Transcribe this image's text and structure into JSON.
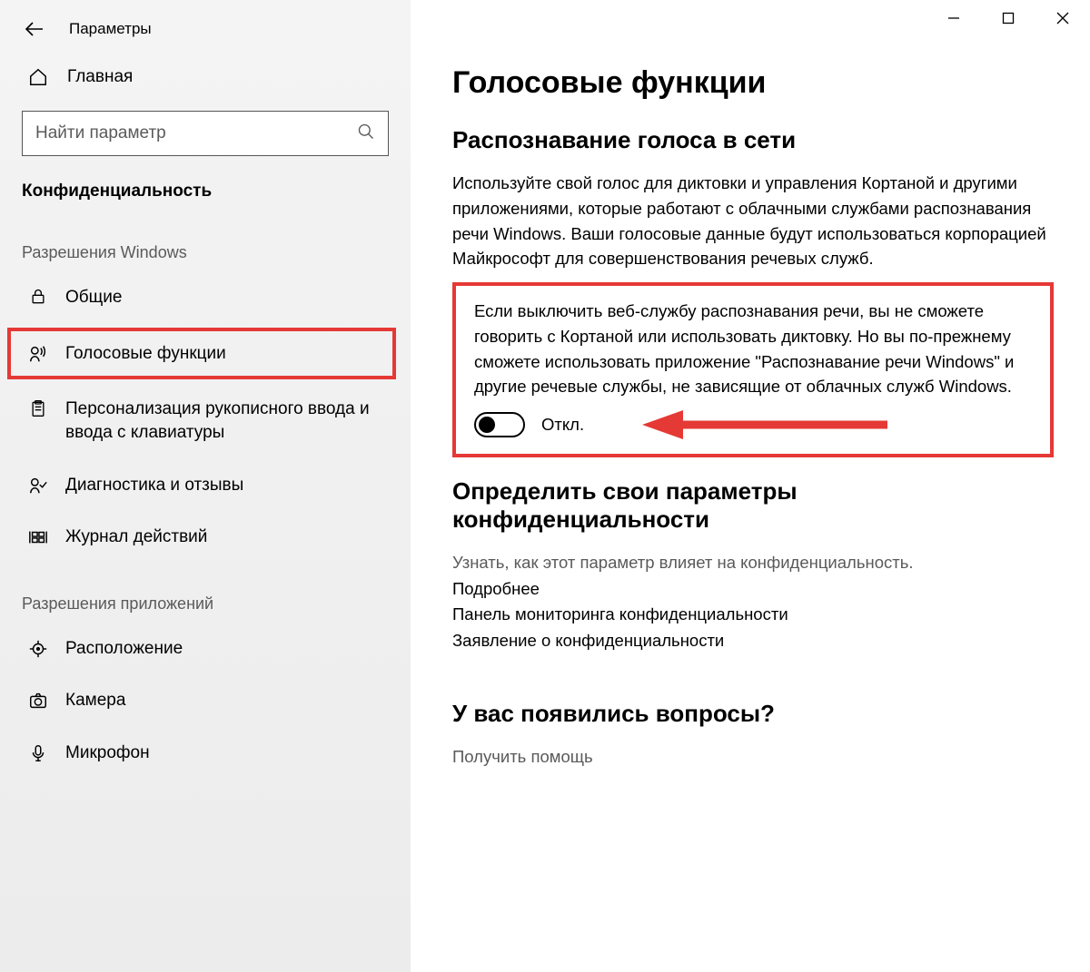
{
  "window": {
    "title": "Параметры"
  },
  "sidebar": {
    "home": "Главная",
    "search_placeholder": "Найти параметр",
    "section": "Конфиденциальность",
    "group1": "Разрешения Windows",
    "items1": [
      {
        "label": "Общие"
      },
      {
        "label": "Голосовые функции"
      },
      {
        "label": "Персонализация рукописного ввода и ввода с клавиатуры"
      },
      {
        "label": "Диагностика и отзывы"
      },
      {
        "label": "Журнал действий"
      }
    ],
    "group2": "Разрешения приложений",
    "items2": [
      {
        "label": "Расположение"
      },
      {
        "label": "Камера"
      },
      {
        "label": "Микрофон"
      }
    ]
  },
  "main": {
    "heading": "Голосовые функции",
    "sub1": "Распознавание голоса в сети",
    "p1": "Используйте свой голос для диктовки и управления Кортаной и другими приложениями, которые работают с облачными службами распознавания речи Windows. Ваши голосовые данные будут использоваться корпорацией Майкрософт для совершенствования речевых служб.",
    "p2": "Если выключить веб-службу распознавания речи, вы не сможете говорить с Кортаной или использовать диктовку. Но вы по-прежнему сможете использовать приложение \"Распознавание речи Windows\" и другие речевые службы, не зависящие от облачных служб Windows.",
    "toggle_label": "Откл.",
    "sub2": "Определить свои параметры конфиденциальности",
    "p3": "Узнать, как этот параметр влияет на конфиденциальность.",
    "links": [
      "Подробнее",
      "Панель мониторинга конфиденциальности",
      "Заявление о конфиденциальности"
    ],
    "sub3": "У вас появились вопросы?",
    "help": "Получить помощь"
  }
}
